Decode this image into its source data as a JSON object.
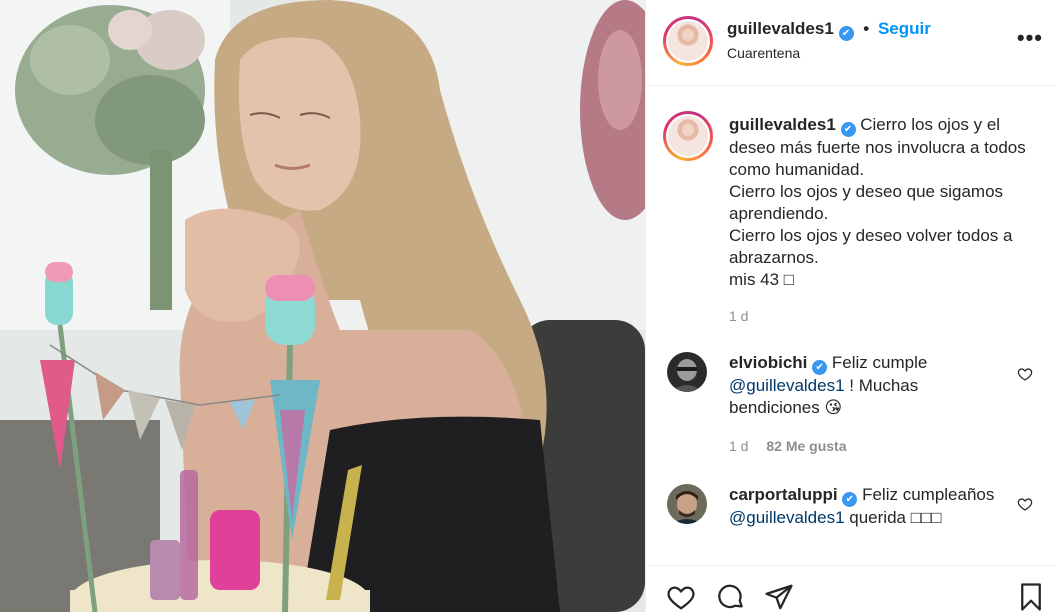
{
  "post": {
    "username": "guillevaldes1",
    "verified_mark": "✔",
    "separator": "•",
    "follow_label": "Seguir",
    "location": "Cuarentena",
    "more_label": "•••",
    "caption": {
      "username": "guillevaldes1",
      "lines": [
        "Cierro los ojos y el deseo más fuerte nos involucra a todos como humanidad.",
        "Cierro los ojos y deseo que sigamos aprendiendo.",
        "Cierro los ojos y deseo volver todos a abrazarnos.",
        "mis 43 □"
      ],
      "time": "1 d"
    }
  },
  "comments": [
    {
      "username": "elviobichi",
      "text_before": "Feliz cumple ",
      "mention": "@guillevaldes1",
      "text_after": " ! Muchas bendiciones 😘",
      "time": "1 d",
      "likes": "82 Me gusta"
    },
    {
      "username": "carportaluppi",
      "text_before": "Feliz cumpleaños ",
      "mention": "@guillevaldes1",
      "text_after": " querida □□□"
    }
  ],
  "icons": {
    "like": "heart-icon",
    "comment": "comment-icon",
    "share": "share-icon",
    "save": "bookmark-icon",
    "more": "more-options-icon"
  },
  "colors": {
    "follow": "#0095f6",
    "verified": "#3897f0",
    "mention": "#00376b",
    "muted": "#8e8e8e"
  }
}
